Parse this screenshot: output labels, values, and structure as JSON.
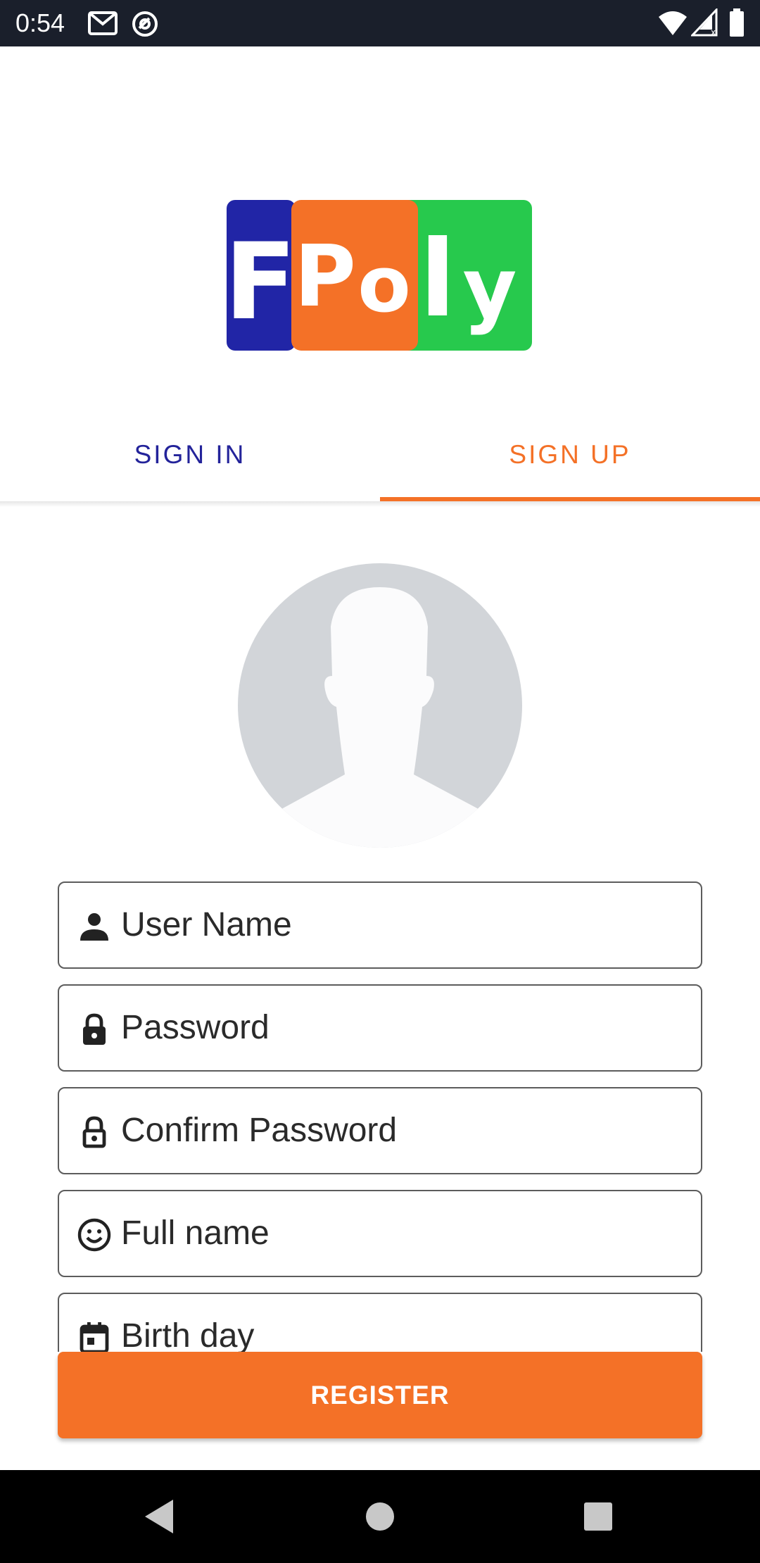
{
  "status_bar": {
    "time": "0:54",
    "left_icons": [
      "gmail-icon",
      "sync-icon"
    ],
    "right_icons": [
      "wifi-icon",
      "cell-signal-icon",
      "battery-icon"
    ]
  },
  "logo": {
    "letters": [
      "F",
      "P",
      "o",
      "l",
      "y"
    ],
    "colors": {
      "blue": "#2125a6",
      "orange": "#f47127",
      "green": "#27c94d"
    }
  },
  "tabs": {
    "sign_in": "SIGN IN",
    "sign_up": "SIGN UP",
    "active": "sign_up"
  },
  "avatar": {
    "icon": "default-avatar-icon"
  },
  "form": {
    "fields": [
      {
        "placeholder": "User Name",
        "icon": "person-icon"
      },
      {
        "placeholder": "Password",
        "icon": "lock-icon"
      },
      {
        "placeholder": "Confirm Password",
        "icon": "lock-outline-icon"
      },
      {
        "placeholder": "Full name",
        "icon": "smiley-icon"
      },
      {
        "placeholder": "Birth day",
        "icon": "calendar-icon"
      }
    ],
    "register_label": "REGISTER"
  },
  "colors": {
    "accent": "#f47127",
    "primary": "#23239a",
    "status_bar": "#1a1f2b"
  },
  "nav_bar": {
    "icons": [
      "back-icon",
      "home-icon",
      "recents-icon"
    ]
  }
}
